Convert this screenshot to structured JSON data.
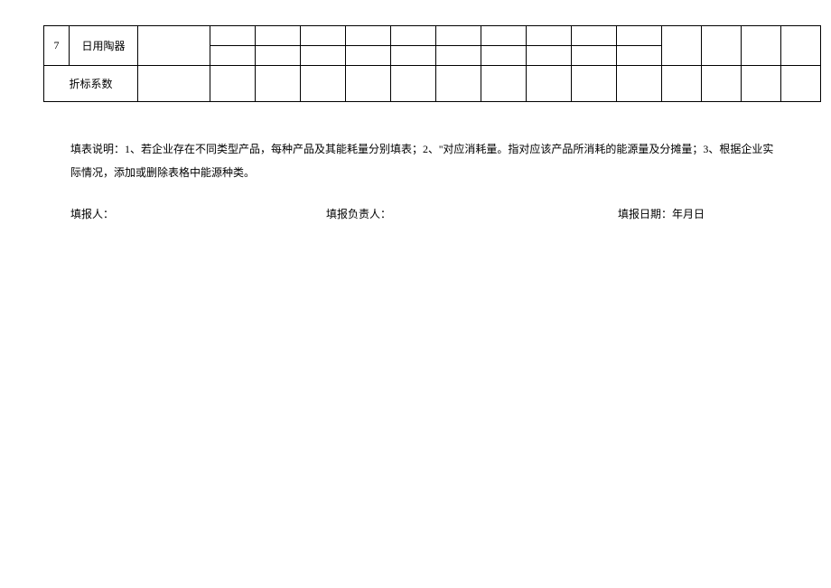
{
  "table": {
    "row7_num": "7",
    "row7_name": "日用陶器",
    "row_total_label": "折标系数"
  },
  "notes": {
    "text": "填表说明：1、若企业存在不同类型产品，每种产品及其能耗量分别填表；2、''对应消耗量。指对应该产品所消耗的能源量及分摊量；3、根据企业实际情况，添加或删除表格中能源种类。"
  },
  "filler": {
    "person_label": "填报人：",
    "responsible_label": "填报负责人：",
    "date_label": "填报日期：年月日"
  }
}
